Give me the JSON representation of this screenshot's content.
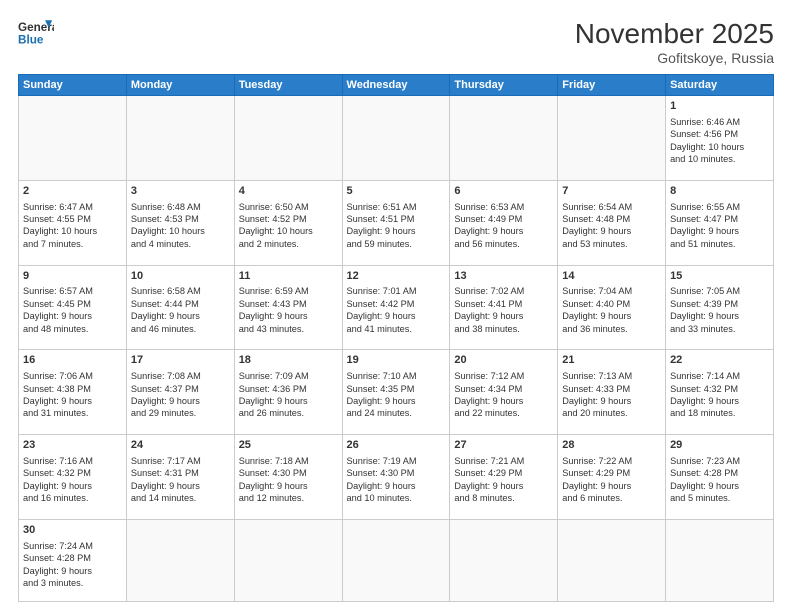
{
  "header": {
    "logo_general": "General",
    "logo_blue": "Blue",
    "month_year": "November 2025",
    "location": "Gofitskoye, Russia"
  },
  "days_of_week": [
    "Sunday",
    "Monday",
    "Tuesday",
    "Wednesday",
    "Thursday",
    "Friday",
    "Saturday"
  ],
  "weeks": [
    [
      {
        "day": "",
        "info": ""
      },
      {
        "day": "",
        "info": ""
      },
      {
        "day": "",
        "info": ""
      },
      {
        "day": "",
        "info": ""
      },
      {
        "day": "",
        "info": ""
      },
      {
        "day": "",
        "info": ""
      },
      {
        "day": "1",
        "info": "Sunrise: 6:46 AM\nSunset: 4:56 PM\nDaylight: 10 hours\nand 10 minutes."
      }
    ],
    [
      {
        "day": "2",
        "info": "Sunrise: 6:47 AM\nSunset: 4:55 PM\nDaylight: 10 hours\nand 7 minutes."
      },
      {
        "day": "3",
        "info": "Sunrise: 6:48 AM\nSunset: 4:53 PM\nDaylight: 10 hours\nand 4 minutes."
      },
      {
        "day": "4",
        "info": "Sunrise: 6:50 AM\nSunset: 4:52 PM\nDaylight: 10 hours\nand 2 minutes."
      },
      {
        "day": "5",
        "info": "Sunrise: 6:51 AM\nSunset: 4:51 PM\nDaylight: 9 hours\nand 59 minutes."
      },
      {
        "day": "6",
        "info": "Sunrise: 6:53 AM\nSunset: 4:49 PM\nDaylight: 9 hours\nand 56 minutes."
      },
      {
        "day": "7",
        "info": "Sunrise: 6:54 AM\nSunset: 4:48 PM\nDaylight: 9 hours\nand 53 minutes."
      },
      {
        "day": "8",
        "info": "Sunrise: 6:55 AM\nSunset: 4:47 PM\nDaylight: 9 hours\nand 51 minutes."
      }
    ],
    [
      {
        "day": "9",
        "info": "Sunrise: 6:57 AM\nSunset: 4:45 PM\nDaylight: 9 hours\nand 48 minutes."
      },
      {
        "day": "10",
        "info": "Sunrise: 6:58 AM\nSunset: 4:44 PM\nDaylight: 9 hours\nand 46 minutes."
      },
      {
        "day": "11",
        "info": "Sunrise: 6:59 AM\nSunset: 4:43 PM\nDaylight: 9 hours\nand 43 minutes."
      },
      {
        "day": "12",
        "info": "Sunrise: 7:01 AM\nSunset: 4:42 PM\nDaylight: 9 hours\nand 41 minutes."
      },
      {
        "day": "13",
        "info": "Sunrise: 7:02 AM\nSunset: 4:41 PM\nDaylight: 9 hours\nand 38 minutes."
      },
      {
        "day": "14",
        "info": "Sunrise: 7:04 AM\nSunset: 4:40 PM\nDaylight: 9 hours\nand 36 minutes."
      },
      {
        "day": "15",
        "info": "Sunrise: 7:05 AM\nSunset: 4:39 PM\nDaylight: 9 hours\nand 33 minutes."
      }
    ],
    [
      {
        "day": "16",
        "info": "Sunrise: 7:06 AM\nSunset: 4:38 PM\nDaylight: 9 hours\nand 31 minutes."
      },
      {
        "day": "17",
        "info": "Sunrise: 7:08 AM\nSunset: 4:37 PM\nDaylight: 9 hours\nand 29 minutes."
      },
      {
        "day": "18",
        "info": "Sunrise: 7:09 AM\nSunset: 4:36 PM\nDaylight: 9 hours\nand 26 minutes."
      },
      {
        "day": "19",
        "info": "Sunrise: 7:10 AM\nSunset: 4:35 PM\nDaylight: 9 hours\nand 24 minutes."
      },
      {
        "day": "20",
        "info": "Sunrise: 7:12 AM\nSunset: 4:34 PM\nDaylight: 9 hours\nand 22 minutes."
      },
      {
        "day": "21",
        "info": "Sunrise: 7:13 AM\nSunset: 4:33 PM\nDaylight: 9 hours\nand 20 minutes."
      },
      {
        "day": "22",
        "info": "Sunrise: 7:14 AM\nSunset: 4:32 PM\nDaylight: 9 hours\nand 18 minutes."
      }
    ],
    [
      {
        "day": "23",
        "info": "Sunrise: 7:16 AM\nSunset: 4:32 PM\nDaylight: 9 hours\nand 16 minutes."
      },
      {
        "day": "24",
        "info": "Sunrise: 7:17 AM\nSunset: 4:31 PM\nDaylight: 9 hours\nand 14 minutes."
      },
      {
        "day": "25",
        "info": "Sunrise: 7:18 AM\nSunset: 4:30 PM\nDaylight: 9 hours\nand 12 minutes."
      },
      {
        "day": "26",
        "info": "Sunrise: 7:19 AM\nSunset: 4:30 PM\nDaylight: 9 hours\nand 10 minutes."
      },
      {
        "day": "27",
        "info": "Sunrise: 7:21 AM\nSunset: 4:29 PM\nDaylight: 9 hours\nand 8 minutes."
      },
      {
        "day": "28",
        "info": "Sunrise: 7:22 AM\nSunset: 4:29 PM\nDaylight: 9 hours\nand 6 minutes."
      },
      {
        "day": "29",
        "info": "Sunrise: 7:23 AM\nSunset: 4:28 PM\nDaylight: 9 hours\nand 5 minutes."
      }
    ],
    [
      {
        "day": "30",
        "info": "Sunrise: 7:24 AM\nSunset: 4:28 PM\nDaylight: 9 hours\nand 3 minutes."
      },
      {
        "day": "",
        "info": ""
      },
      {
        "day": "",
        "info": ""
      },
      {
        "day": "",
        "info": ""
      },
      {
        "day": "",
        "info": ""
      },
      {
        "day": "",
        "info": ""
      },
      {
        "day": "",
        "info": ""
      }
    ]
  ]
}
